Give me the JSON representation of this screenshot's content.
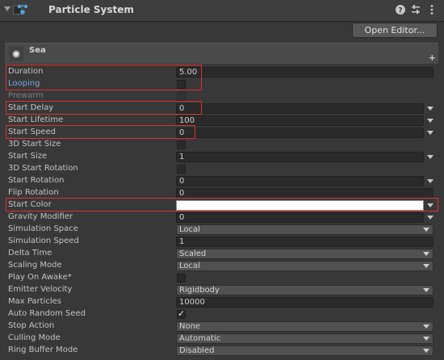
{
  "header": {
    "title": "Particle System",
    "icons": [
      "foldout-arrow-icon",
      "enabled-checkbox",
      "particle-system-icon",
      "help-icon",
      "presets-icon",
      "more-menu-icon"
    ]
  },
  "toolbar": {
    "open_editor_label": "Open Editor..."
  },
  "module": {
    "name": "Sea",
    "add_label": "+"
  },
  "properties": {
    "duration": {
      "label": "Duration",
      "value": "5.00"
    },
    "looping": {
      "label": "Looping",
      "checked": false
    },
    "prewarm": {
      "label": "Prewarm",
      "checked": false
    },
    "start_delay": {
      "label": "Start Delay",
      "value": "0"
    },
    "start_lifetime": {
      "label": "Start Lifetime",
      "value": "100"
    },
    "start_speed": {
      "label": "Start Speed",
      "value": "0"
    },
    "start_size_3d": {
      "label": "3D Start Size",
      "checked": false
    },
    "start_size": {
      "label": "Start Size",
      "value": "1"
    },
    "start_rotation_3d": {
      "label": "3D Start Rotation",
      "checked": false
    },
    "start_rotation": {
      "label": "Start Rotation",
      "value": "0"
    },
    "flip_rotation": {
      "label": "Flip Rotation",
      "value": "0"
    },
    "start_color": {
      "label": "Start Color",
      "value": "#ffffff"
    },
    "gravity_modifier": {
      "label": "Gravity Modifier",
      "value": "0"
    },
    "simulation_space": {
      "label": "Simulation Space",
      "value": "Local"
    },
    "simulation_speed": {
      "label": "Simulation Speed",
      "value": "1"
    },
    "delta_time": {
      "label": "Delta Time",
      "value": "Scaled"
    },
    "scaling_mode": {
      "label": "Scaling Mode",
      "value": "Local"
    },
    "play_on_awake": {
      "label": "Play On Awake*",
      "checked": false
    },
    "emitter_velocity": {
      "label": "Emitter Velocity",
      "value": "Rigidbody"
    },
    "max_particles": {
      "label": "Max Particles",
      "value": "10000"
    },
    "auto_random_seed": {
      "label": "Auto Random Seed",
      "checked": true
    },
    "stop_action": {
      "label": "Stop Action",
      "value": "None"
    },
    "culling_mode": {
      "label": "Culling Mode",
      "value": "Automatic"
    },
    "ring_buffer_mode": {
      "label": "Ring Buffer Mode",
      "value": "Disabled"
    }
  },
  "colors": {
    "panel_bg": "#383838",
    "field_bg": "#2a2a2a",
    "highlight": "#e03030",
    "blue_label": "#7aa6dd"
  }
}
